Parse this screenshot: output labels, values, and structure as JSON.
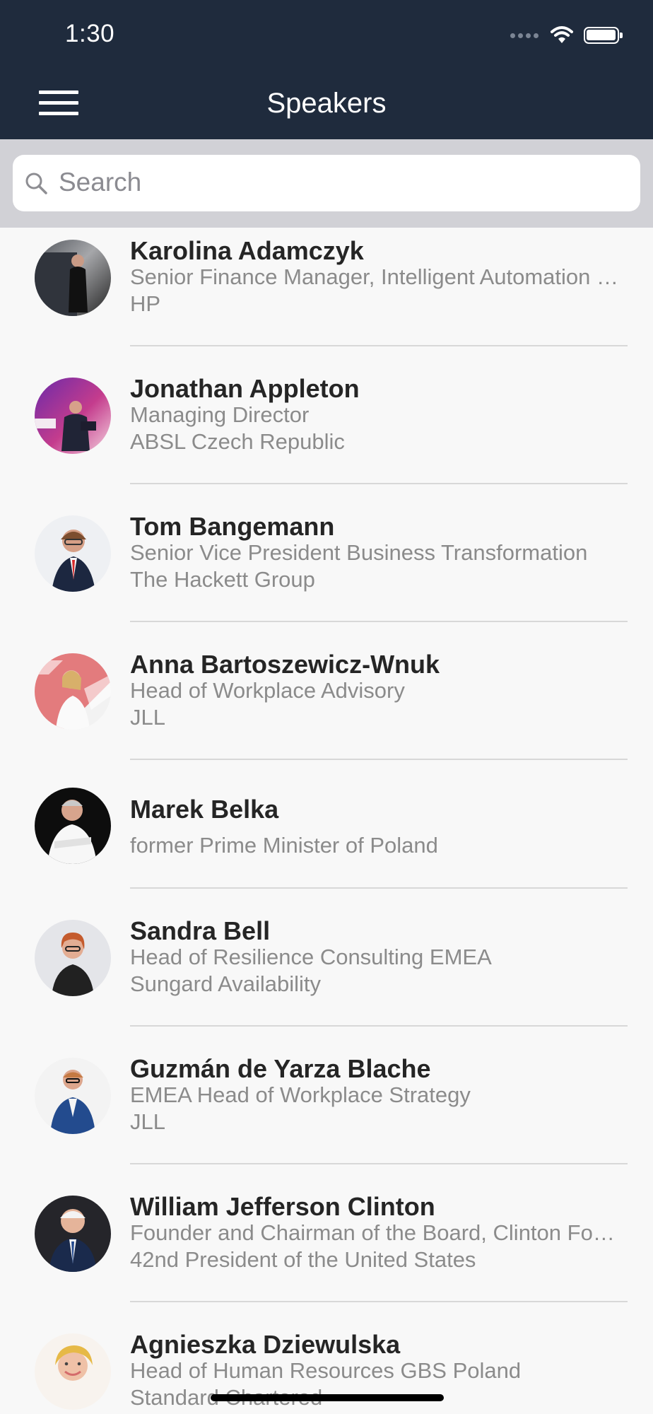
{
  "status_bar": {
    "time": "1:30"
  },
  "header": {
    "title": "Speakers"
  },
  "search": {
    "placeholder": "Search",
    "value": ""
  },
  "speakers": [
    {
      "name": "Karolina Adamczyk",
      "title": "Senior Finance Manager, Intelligent Automation Finance Operations",
      "company": "HP"
    },
    {
      "name": "Jonathan Appleton",
      "title": "Managing Director",
      "company": "ABSL Czech Republic"
    },
    {
      "name": "Tom Bangemann",
      "title": "Senior Vice President Business Transformation",
      "company": "The Hackett Group"
    },
    {
      "name": "Anna Bartoszewicz-Wnuk",
      "title": "Head of Workplace Advisory",
      "company": "JLL"
    },
    {
      "name": "Marek Belka",
      "title": "former Prime Minister of Poland",
      "company": ""
    },
    {
      "name": "Sandra Bell",
      "title": "Head of Resilience Consulting EMEA",
      "company": "Sungard Availability"
    },
    {
      "name": "Guzmán de Yarza Blache",
      "title": "EMEA Head of Workplace Strategy",
      "company": "JLL"
    },
    {
      "name": "William Jefferson Clinton",
      "title": "Founder and Chairman of the Board, Clinton Foundation",
      "company": "42nd President of the United States"
    },
    {
      "name": "Agnieszka Dziewulska",
      "title": "Head of Human Resources GBS Poland",
      "company": "Standard Chartered"
    }
  ]
}
